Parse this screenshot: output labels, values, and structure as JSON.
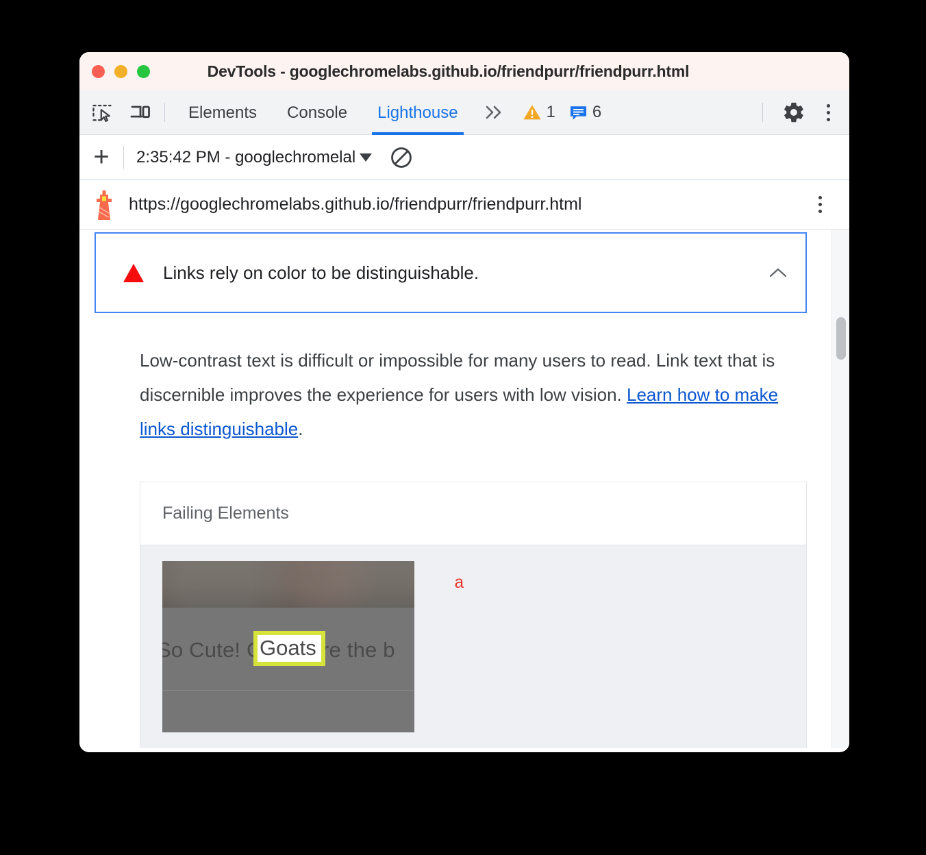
{
  "window": {
    "title": "DevTools - googlechromelabs.github.io/friendpurr/friendpurr.html",
    "traffic_lights": [
      "close",
      "minimize",
      "maximize"
    ]
  },
  "devtools_tabs": {
    "inspect_icon": "inspect-element-icon",
    "device_icon": "device-toolbar-icon",
    "tabs": [
      {
        "label": "Elements",
        "active": false
      },
      {
        "label": "Console",
        "active": false
      },
      {
        "label": "Lighthouse",
        "active": true
      }
    ],
    "more_tabs_label": "»",
    "warning_count": "1",
    "message_count": "6",
    "settings_icon": "gear-icon",
    "menu_icon": "vertical-dots-icon"
  },
  "run_toolbar": {
    "add_label": "+",
    "selected_run": "2:35:42 PM - googlechromelal",
    "clear_icon": "no-entry-clear-icon"
  },
  "url_bar": {
    "lighthouse_icon": "lighthouse-icon",
    "url": "https://googlechromelabs.github.io/friendpurr/friendpurr.html",
    "menu_icon": "vertical-dots-icon"
  },
  "audit": {
    "severity_icon": "red-triangle-fail-icon",
    "title": "Links rely on color to be distinguishable.",
    "collapse_icon": "chevron-up-icon",
    "description_before": "Low-contrast text is difficult or impossible for many users to read. Link text that is discernible improves the experience for users with low vision. ",
    "description_link": "Learn how to make links distinguishable",
    "description_after": ".",
    "border_color": "#4285f4"
  },
  "failing_elements": {
    "header": "Failing Elements",
    "rows": [
      {
        "thumbnail_text": "So Cute! Goats are the b",
        "highlighted_text": "Goats",
        "highlight_color": "#d6e33a",
        "selector": "a",
        "selector_color": "#e8392e"
      }
    ]
  },
  "scrollbar": {
    "thumb": "vertical-scrollbar-thumb"
  }
}
